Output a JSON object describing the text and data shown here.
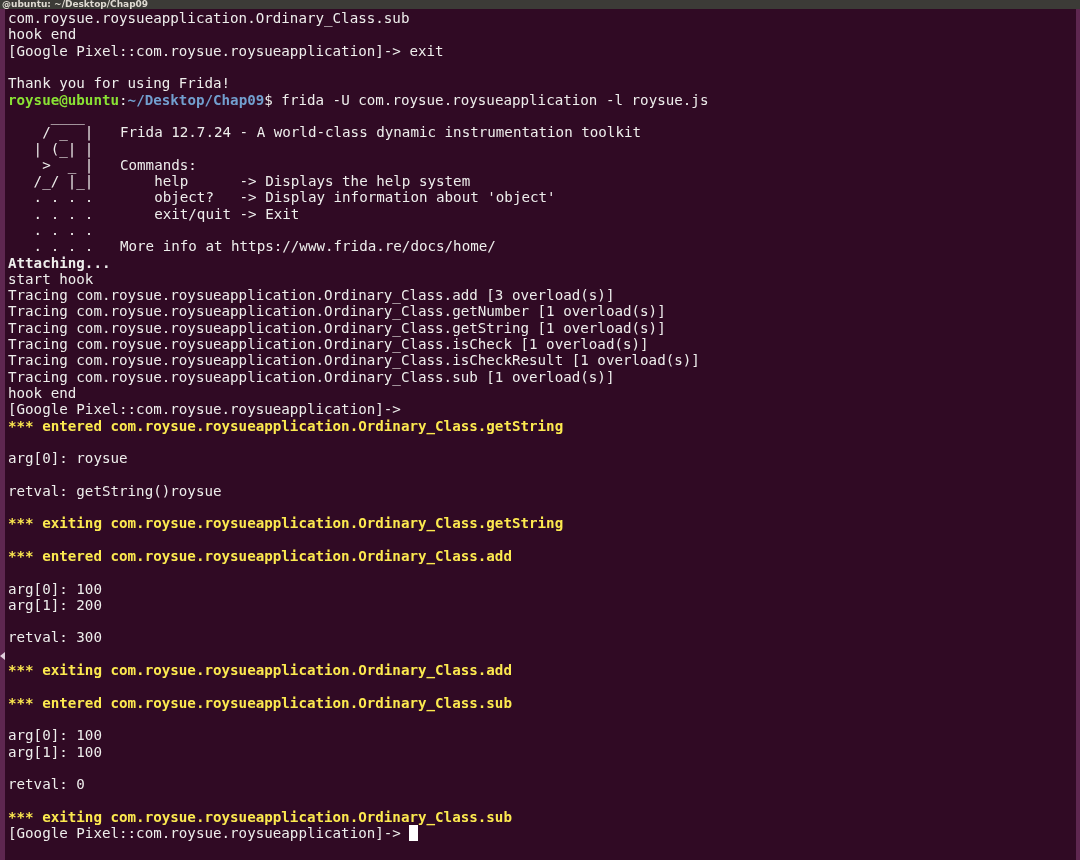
{
  "window": {
    "title": "@ubuntu: ~/Desktop/Chap09"
  },
  "lines": [
    {
      "kind": "plain",
      "text": "com.roysue.roysueapplication.Ordinary_Class.sub"
    },
    {
      "kind": "plain",
      "text": "hook end"
    },
    {
      "kind": "plain",
      "text": "[Google Pixel::com.roysue.roysueapplication]-> exit"
    },
    {
      "kind": "blank"
    },
    {
      "kind": "plain",
      "text": "Thank you for using Frida!"
    },
    {
      "kind": "prompt",
      "user": "roysue@ubuntu",
      "separator": ":",
      "path": "~/Desktop/Chap09",
      "symbol": "$",
      "command": " frida -U com.roysue.roysueapplication -l roysue.js"
    },
    {
      "kind": "banner",
      "art": "     ____"
    },
    {
      "kind": "banner",
      "art": "    / _  |",
      "text": "Frida 12.7.24 - A world-class dynamic instrumentation toolkit"
    },
    {
      "kind": "banner",
      "art": "   | (_| |"
    },
    {
      "kind": "banner",
      "art": "    >  _ |",
      "text": "Commands:"
    },
    {
      "kind": "banner",
      "art": "   /_/ |_|",
      "text": "    help      -> Displays the help system"
    },
    {
      "kind": "banner",
      "art": "   . . . .",
      "text": "    object?   -> Display information about 'object'"
    },
    {
      "kind": "banner",
      "art": "   . . . .",
      "text": "    exit/quit -> Exit"
    },
    {
      "kind": "banner",
      "art": "   . . . ."
    },
    {
      "kind": "banner",
      "art": "   . . . .",
      "text": "More info at https://www.frida.re/docs/home/"
    },
    {
      "kind": "bold",
      "text": "Attaching..."
    },
    {
      "kind": "plain",
      "text": "start hook"
    },
    {
      "kind": "plain",
      "text": "Tracing com.roysue.roysueapplication.Ordinary_Class.add [3 overload(s)]"
    },
    {
      "kind": "plain",
      "text": "Tracing com.roysue.roysueapplication.Ordinary_Class.getNumber [1 overload(s)]"
    },
    {
      "kind": "plain",
      "text": "Tracing com.roysue.roysueapplication.Ordinary_Class.getString [1 overload(s)]"
    },
    {
      "kind": "plain",
      "text": "Tracing com.roysue.roysueapplication.Ordinary_Class.isCheck [1 overload(s)]"
    },
    {
      "kind": "plain",
      "text": "Tracing com.roysue.roysueapplication.Ordinary_Class.isCheckResult [1 overload(s)]"
    },
    {
      "kind": "plain",
      "text": "Tracing com.roysue.roysueapplication.Ordinary_Class.sub [1 overload(s)]"
    },
    {
      "kind": "plain",
      "text": "hook end"
    },
    {
      "kind": "plain",
      "text": "[Google Pixel::com.roysue.roysueapplication]->"
    },
    {
      "kind": "highlight",
      "text": "*** entered com.roysue.roysueapplication.Ordinary_Class.getString"
    },
    {
      "kind": "blank"
    },
    {
      "kind": "plain",
      "text": "arg[0]: roysue"
    },
    {
      "kind": "blank"
    },
    {
      "kind": "plain",
      "text": "retval: getString()roysue"
    },
    {
      "kind": "blank"
    },
    {
      "kind": "highlight",
      "text": "*** exiting com.roysue.roysueapplication.Ordinary_Class.getString"
    },
    {
      "kind": "blank"
    },
    {
      "kind": "highlight",
      "text": "*** entered com.roysue.roysueapplication.Ordinary_Class.add"
    },
    {
      "kind": "blank"
    },
    {
      "kind": "plain",
      "text": "arg[0]: 100"
    },
    {
      "kind": "plain",
      "text": "arg[1]: 200"
    },
    {
      "kind": "blank"
    },
    {
      "kind": "plain",
      "text": "retval: 300"
    },
    {
      "kind": "blank"
    },
    {
      "kind": "highlight",
      "text": "*** exiting com.roysue.roysueapplication.Ordinary_Class.add"
    },
    {
      "kind": "blank"
    },
    {
      "kind": "highlight",
      "text": "*** entered com.roysue.roysueapplication.Ordinary_Class.sub"
    },
    {
      "kind": "blank"
    },
    {
      "kind": "plain",
      "text": "arg[0]: 100"
    },
    {
      "kind": "plain",
      "text": "arg[1]: 100"
    },
    {
      "kind": "blank"
    },
    {
      "kind": "plain",
      "text": "retval: 0"
    },
    {
      "kind": "blank"
    },
    {
      "kind": "highlight",
      "text": "*** exiting com.roysue.roysueapplication.Ordinary_Class.sub"
    },
    {
      "kind": "plain",
      "text": "[Google Pixel::com.roysue.roysueapplication]->",
      "cursor": true
    }
  ]
}
